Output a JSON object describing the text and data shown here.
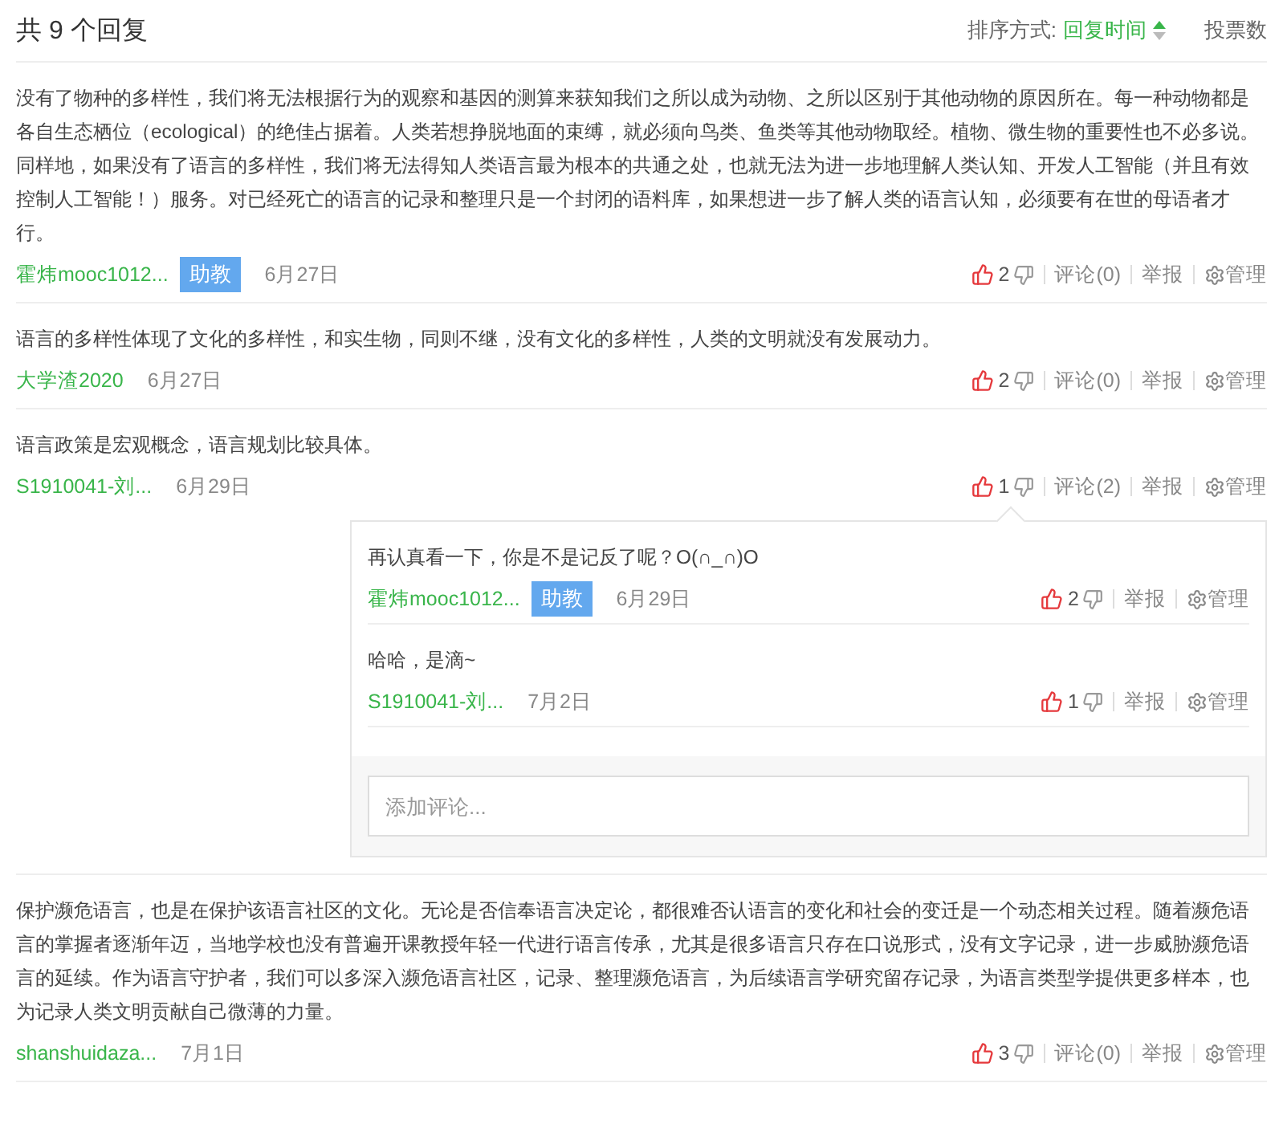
{
  "header": {
    "title": "共 9 个回复",
    "sort_label": "排序方式:",
    "sort_options": [
      {
        "label": "回复时间",
        "selected": true
      },
      {
        "label": "投票数",
        "selected": false
      }
    ]
  },
  "posts": [
    {
      "paragraphs": [
        "没有了物种的多样性，我们将无法根据行为的观察和基因的测算来获知我们之所以成为动物、之所以区别于其他动物的原因所在。每一种动物都是各自生态栖位（ecological）的绝佳占据着。人类若想挣脱地面的束缚，就必须向鸟类、鱼类等其他动物取经。植物、微生物的重要性也不必多说。",
        "同样地，如果没有了语言的多样性，我们将无法得知人类语言最为根本的共通之处，也就无法为进一步地理解人类认知、开发人工智能（并且有效控制人工智能！）服务。对已经死亡的语言的记录和整理只是一个封闭的语料库，如果想进一步了解人类的语言认知，必须要有在世的母语者才行。"
      ],
      "author": "霍炜mooc1012...",
      "badge": "助教",
      "date": "6月27日",
      "likes": "2",
      "comments": "评论(0)",
      "report": "举报",
      "manage": "管理"
    },
    {
      "paragraphs": [
        "语言的多样性体现了文化的多样性，和实生物，同则不继，没有文化的多样性，人类的文明就没有发展动力。"
      ],
      "author": "大学渣2020",
      "date": "6月27日",
      "likes": "2",
      "comments": "评论(0)",
      "report": "举报",
      "manage": "管理"
    },
    {
      "paragraphs": [
        "语言政策是宏观概念，语言规划比较具体。"
      ],
      "author": "S1910041-刘...",
      "date": "6月29日",
      "likes": "1",
      "comments": "评论(2)",
      "report": "举报",
      "manage": "管理",
      "thread": {
        "replies": [
          {
            "text": "再认真看一下，你是不是记反了呢？O(∩_∩)O",
            "author": "霍炜mooc1012...",
            "badge": "助教",
            "date": "6月29日",
            "likes": "2",
            "report": "举报",
            "manage": "管理"
          },
          {
            "text": "哈哈，是滴~",
            "author": "S1910041-刘...",
            "date": "7月2日",
            "likes": "1",
            "report": "举报",
            "manage": "管理"
          }
        ],
        "input": {
          "placeholder": "添加评论..."
        }
      }
    },
    {
      "paragraphs": [
        "保护濒危语言，也是在保护该语言社区的文化。无论是否信奉语言决定论，都很难否认语言的变化和社会的变迁是一个动态相关过程。随着濒危语言的掌握者逐渐年迈，当地学校也没有普遍开课教授年轻一代进行语言传承，尤其是很多语言只存在口说形式，没有文字记录，进一步威胁濒危语言的延续。作为语言守护者，我们可以多深入濒危语言社区，记录、整理濒危语言，为后续语言学研究留存记录，为语言类型学提供更多样本，也为记录人类文明贡献自己微薄的力量。"
      ],
      "author": "shanshuidaza...",
      "date": "7月1日",
      "likes": "3",
      "comments": "评论(0)",
      "report": "举报",
      "manage": "管理"
    }
  ]
}
